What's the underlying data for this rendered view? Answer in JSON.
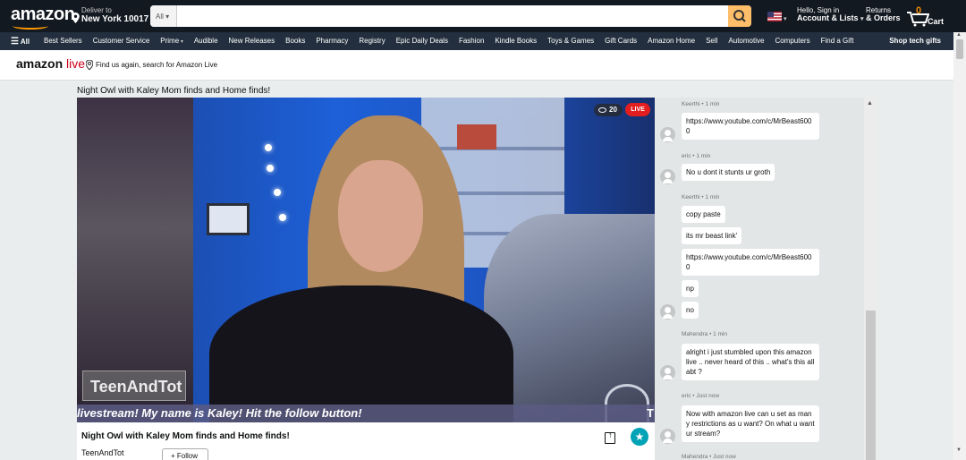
{
  "header": {
    "logo": "amazon",
    "deliver_small": "Deliver to",
    "deliver_big": "New York 10017",
    "search_category": "All",
    "search_placeholder": "",
    "account_small": "Hello, Sign in",
    "account_big": "Account & Lists",
    "returns_small": "Returns",
    "returns_big": "& Orders",
    "cart_count": "0",
    "cart_label": "Cart"
  },
  "nav": {
    "all": "All",
    "items": [
      "Best Sellers",
      "Customer Service",
      "Prime",
      "Audible",
      "New Releases",
      "Books",
      "Pharmacy",
      "Registry",
      "Epic Daily Deals",
      "Fashion",
      "Kindle Books",
      "Toys & Games",
      "Gift Cards",
      "Amazon Home",
      "Sell",
      "Automotive",
      "Computers",
      "Find a Gift"
    ],
    "shop_tech": "Shop tech gifts"
  },
  "live_header": {
    "brand_amazon": "amazon",
    "brand_live": "live",
    "find_text": "Find us again, search for Amazon Live"
  },
  "stream": {
    "page_title": "Night Owl with Kaley Mom finds and Home finds!",
    "viewers": "20",
    "live_label": "LIVE",
    "overlay_handle": "TeenAndTot",
    "overlay_ticker": "livestream! My name is Kaley! Hit the follow button!",
    "overlay_ticker_end": "T",
    "title": "Night Owl with Kaley Mom finds and Home finds!",
    "host": "TeenAndTot",
    "follow_label": "+ Follow"
  },
  "chat": {
    "messages": [
      {
        "author": "Keerthi • 1 min",
        "lines": [
          "https://www.youtube.com/c/MrBeast6000"
        ]
      },
      {
        "author": "eric • 1 min",
        "lines": [
          "No u dont it stunts ur groth"
        ]
      },
      {
        "author": "Keerthi • 1 min",
        "lines": [
          "copy paste",
          "its mr beast link'",
          "https://www.youtube.com/c/MrBeast6000",
          "np",
          "no"
        ]
      },
      {
        "author": "Mahendra • 1 min",
        "lines": [
          "alright i just stumbled upon this amazon live .. never heard of this .. what's this all abt ?"
        ]
      },
      {
        "author": "eric • Just now",
        "lines": [
          "Now with amazon live can u set as many restrictions as u want? On what u want ur stream?"
        ]
      },
      {
        "author": "Mahendra • Just now",
        "lines": []
      }
    ]
  },
  "colors": {
    "header_bg": "#131921",
    "nav_bg": "#232f3e",
    "accent": "#febd69",
    "live_red": "#e41e1e",
    "brand_orange": "#ff9900",
    "star_teal": "#00a3b5"
  }
}
